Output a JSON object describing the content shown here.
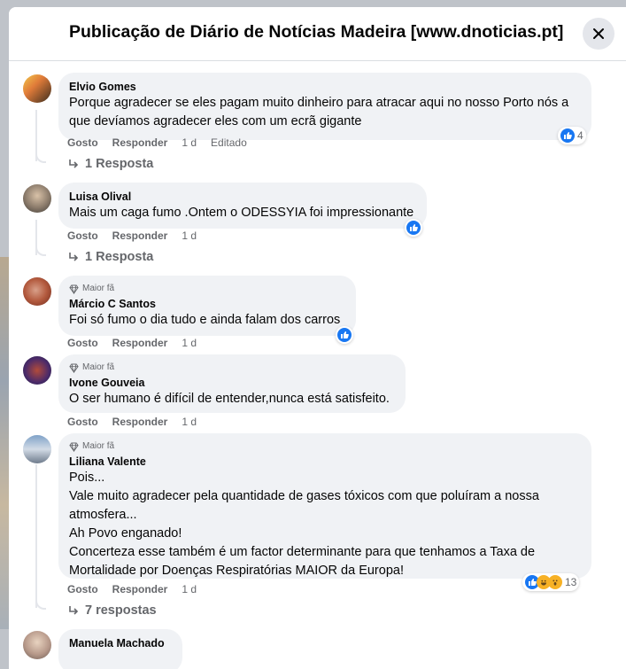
{
  "header": {
    "title": "Publicação de Diário de Notícias Madeira [www.dnoticias.pt]"
  },
  "labels": {
    "like": "Gosto",
    "reply": "Responder",
    "top_fan": "Maior fã"
  },
  "comments": [
    {
      "author": "Elvio Gomes",
      "text": "Porque agradecer se eles pagam muito dinheiro para atracar aqui no nosso Porto nós a que devíamos agradecer eles com um ecrã gigante",
      "time": "1 d",
      "edited": "Editado",
      "reaction_count": "4",
      "replies": "1 Resposta"
    },
    {
      "author": "Luisa Olival",
      "text": "Mais um caga fumo .Ontem o ODESSYIA foi impressionante",
      "time": "1 d",
      "replies": "1 Resposta"
    },
    {
      "author": "Márcio C Santos",
      "text": "Foi só fumo o dia tudo e ainda falam dos carros",
      "time": "1 d"
    },
    {
      "author": "Ivone Gouveia",
      "text": "O ser humano é difícil de entender,nunca está satisfeito.",
      "time": "1 d"
    },
    {
      "author": "Liliana Valente",
      "text": "Pois...\nVale muito agradecer pela quantidade de gases tóxicos com que poluíram a nossa atmosfera...\nAh Povo enganado!\nConcerteza esse também é um factor determinante para que tenhamos a Taxa de Mortalidade por Doenças Respiratórias MAIOR da Europa!",
      "time": "1 d",
      "reaction_count": "13",
      "replies": "7 respostas"
    },
    {
      "author": "Manuela Machado"
    }
  ]
}
